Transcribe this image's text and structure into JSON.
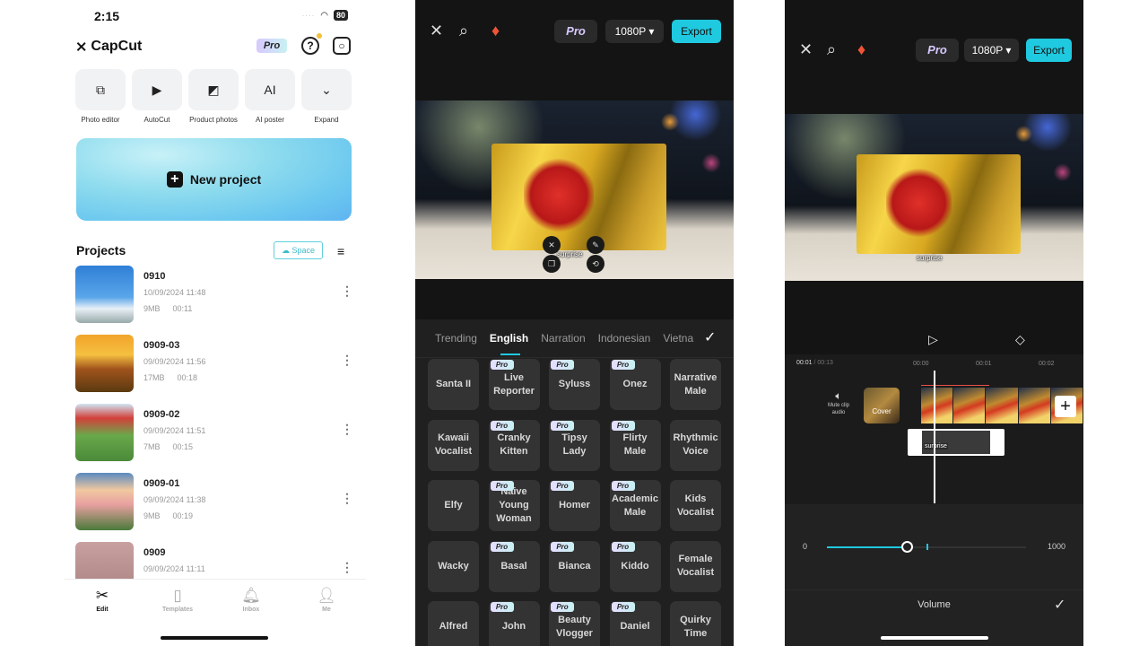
{
  "home": {
    "status": {
      "time": "2:15",
      "battery": "80"
    },
    "brand": "CapCut",
    "pro_label": "Pro",
    "tools": [
      {
        "label": "Photo editor",
        "icon": "photo-editor-icon",
        "glyph": "⧉"
      },
      {
        "label": "AutoCut",
        "icon": "autocut-icon",
        "glyph": "▶"
      },
      {
        "label": "Product photos",
        "icon": "product-photos-icon",
        "glyph": "◩"
      },
      {
        "label": "AI poster",
        "icon": "ai-poster-icon",
        "glyph": "AI"
      },
      {
        "label": "Expand",
        "icon": "chevron-down-icon",
        "glyph": "⌄"
      }
    ],
    "new_project_label": "New project",
    "projects_title": "Projects",
    "space_label": "Space",
    "projects": [
      {
        "name": "0910",
        "date": "10/09/2024 11:48",
        "size": "9MB",
        "duration": "00:11"
      },
      {
        "name": "0909-03",
        "date": "09/09/2024 11:56",
        "size": "17MB",
        "duration": "00:18"
      },
      {
        "name": "0909-02",
        "date": "09/09/2024 11:51",
        "size": "7MB",
        "duration": "00:15"
      },
      {
        "name": "0909-01",
        "date": "09/09/2024 11:38",
        "size": "9MB",
        "duration": "00:19"
      },
      {
        "name": "0909",
        "date": "09/09/2024 11:11",
        "size": "",
        "duration": ""
      }
    ],
    "nav": [
      {
        "label": "Edit",
        "active": true
      },
      {
        "label": "Templates",
        "active": false
      },
      {
        "label": "Inbox",
        "active": false
      },
      {
        "label": "Me",
        "active": false
      }
    ]
  },
  "voice_editor": {
    "pro_label": "Pro",
    "resolution": "1080P",
    "export_label": "Export",
    "caption": "surprise",
    "tabs": [
      "Trending",
      "English",
      "Narration",
      "Indonesian",
      "Vietna"
    ],
    "active_tab": "English",
    "voices": [
      {
        "name": "Santa II",
        "pro": false
      },
      {
        "name": "Live Reporter",
        "pro": true
      },
      {
        "name": "Syluss",
        "pro": true
      },
      {
        "name": "Onez",
        "pro": true
      },
      {
        "name": "Narrative Male",
        "pro": false
      },
      {
        "name": "Kawaii Vocalist",
        "pro": false
      },
      {
        "name": "Cranky Kitten",
        "pro": true
      },
      {
        "name": "Tipsy Lady",
        "pro": true
      },
      {
        "name": "Flirty Male",
        "pro": true
      },
      {
        "name": "Rhythmic Voice",
        "pro": false
      },
      {
        "name": "Elfy",
        "pro": false
      },
      {
        "name": "Naive Young Woman",
        "pro": true
      },
      {
        "name": "Homer",
        "pro": true
      },
      {
        "name": "Academic Male",
        "pro": true
      },
      {
        "name": "Kids Vocalist",
        "pro": false
      },
      {
        "name": "Wacky",
        "pro": false
      },
      {
        "name": "Basal",
        "pro": true
      },
      {
        "name": "Bianca",
        "pro": true
      },
      {
        "name": "Kiddo",
        "pro": true
      },
      {
        "name": "Female Vocalist",
        "pro": false
      },
      {
        "name": "Alfred",
        "pro": false
      },
      {
        "name": "John",
        "pro": true
      },
      {
        "name": "Beauty Vlogger",
        "pro": true
      },
      {
        "name": "Daniel",
        "pro": true
      },
      {
        "name": "Quirky Time",
        "pro": false
      }
    ]
  },
  "volume_editor": {
    "pro_label": "Pro",
    "resolution": "1080P",
    "export_label": "Export",
    "caption": "surprise",
    "current_time": "00:01",
    "total_time": "00:13",
    "ruler": [
      "00:00",
      "00:01",
      "00:02"
    ],
    "mute_label": "Mute clip audio",
    "cover_label": "Cover",
    "text_clip_label": "surprise",
    "volume": {
      "min": "0",
      "max": "1000",
      "value": 400,
      "value_max": 1000,
      "marker": 500
    },
    "title": "Volume"
  },
  "colors": {
    "accent": "#1fc9e0",
    "dark_bg": "#141414",
    "sheet_bg": "#202020",
    "tile_bg": "#333333"
  }
}
